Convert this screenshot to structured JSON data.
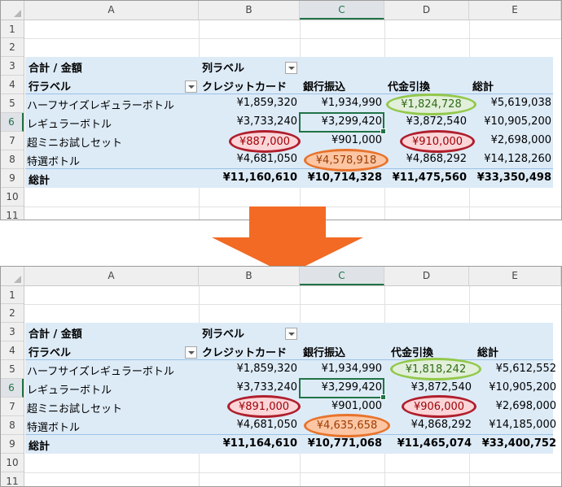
{
  "columns": [
    "A",
    "B",
    "C",
    "D",
    "E"
  ],
  "selected_column": "C",
  "row_numbers": [
    "1",
    "2",
    "3",
    "4",
    "5",
    "6",
    "7",
    "8",
    "9",
    "10",
    "11"
  ],
  "selected_row": "6",
  "colors": {
    "pivot_fill": "#ddebf7",
    "highlight_red_fill": "#fbd5d8",
    "highlight_red_border": "#b01e2c",
    "highlight_orange_fill": "#fcc6a4",
    "highlight_orange_border": "#e8732b",
    "highlight_green_fill": "#e2efda",
    "highlight_green_border": "#92c84a",
    "arrow": "#f26a24",
    "selection": "#217346"
  },
  "top": {
    "pivot_title": "合計 / 金額",
    "col_labels": "列ラベル",
    "row_labels": "行ラベル",
    "headers": [
      "クレジットカード",
      "銀行振込",
      "代金引換",
      "総計"
    ],
    "rows": [
      {
        "label": "ハーフサイズレギュラーボトル",
        "values": [
          "¥1,859,320",
          "¥1,934,990",
          "¥1,824,728",
          "¥5,619,038"
        ]
      },
      {
        "label": "レギュラーボトル",
        "values": [
          "¥3,733,240",
          "¥3,299,420",
          "¥3,872,540",
          "¥10,905,200"
        ]
      },
      {
        "label": "超ミニお試しセット",
        "values": [
          "¥887,000",
          "¥901,000",
          "¥910,000",
          "¥2,698,000"
        ]
      },
      {
        "label": "特選ボトル",
        "values": [
          "¥4,681,050",
          "¥4,578,918",
          "¥4,868,292",
          "¥14,128,260"
        ]
      }
    ],
    "total": {
      "label": "総計",
      "values": [
        "¥11,160,610",
        "¥10,714,328",
        "¥11,475,560",
        "¥33,350,498"
      ]
    }
  },
  "bottom": {
    "pivot_title": "合計 / 金額",
    "col_labels": "列ラベル",
    "row_labels": "行ラベル",
    "headers": [
      "クレジットカード",
      "銀行振込",
      "代金引換",
      "総計"
    ],
    "rows": [
      {
        "label": "ハーフサイズレギュラーボトル",
        "values": [
          "¥1,859,320",
          "¥1,934,990",
          "¥1,818,242",
          "¥5,612,552"
        ]
      },
      {
        "label": "レギュラーボトル",
        "values": [
          "¥3,733,240",
          "¥3,299,420",
          "¥3,872,540",
          "¥10,905,200"
        ]
      },
      {
        "label": "超ミニお試しセット",
        "values": [
          "¥891,000",
          "¥901,000",
          "¥906,000",
          "¥2,698,000"
        ]
      },
      {
        "label": "特選ボトル",
        "values": [
          "¥4,681,050",
          "¥4,635,658",
          "¥4,868,292",
          "¥14,185,000"
        ]
      }
    ],
    "total": {
      "label": "総計",
      "values": [
        "¥11,164,610",
        "¥10,771,068",
        "¥11,465,074",
        "¥33,400,752"
      ]
    }
  }
}
